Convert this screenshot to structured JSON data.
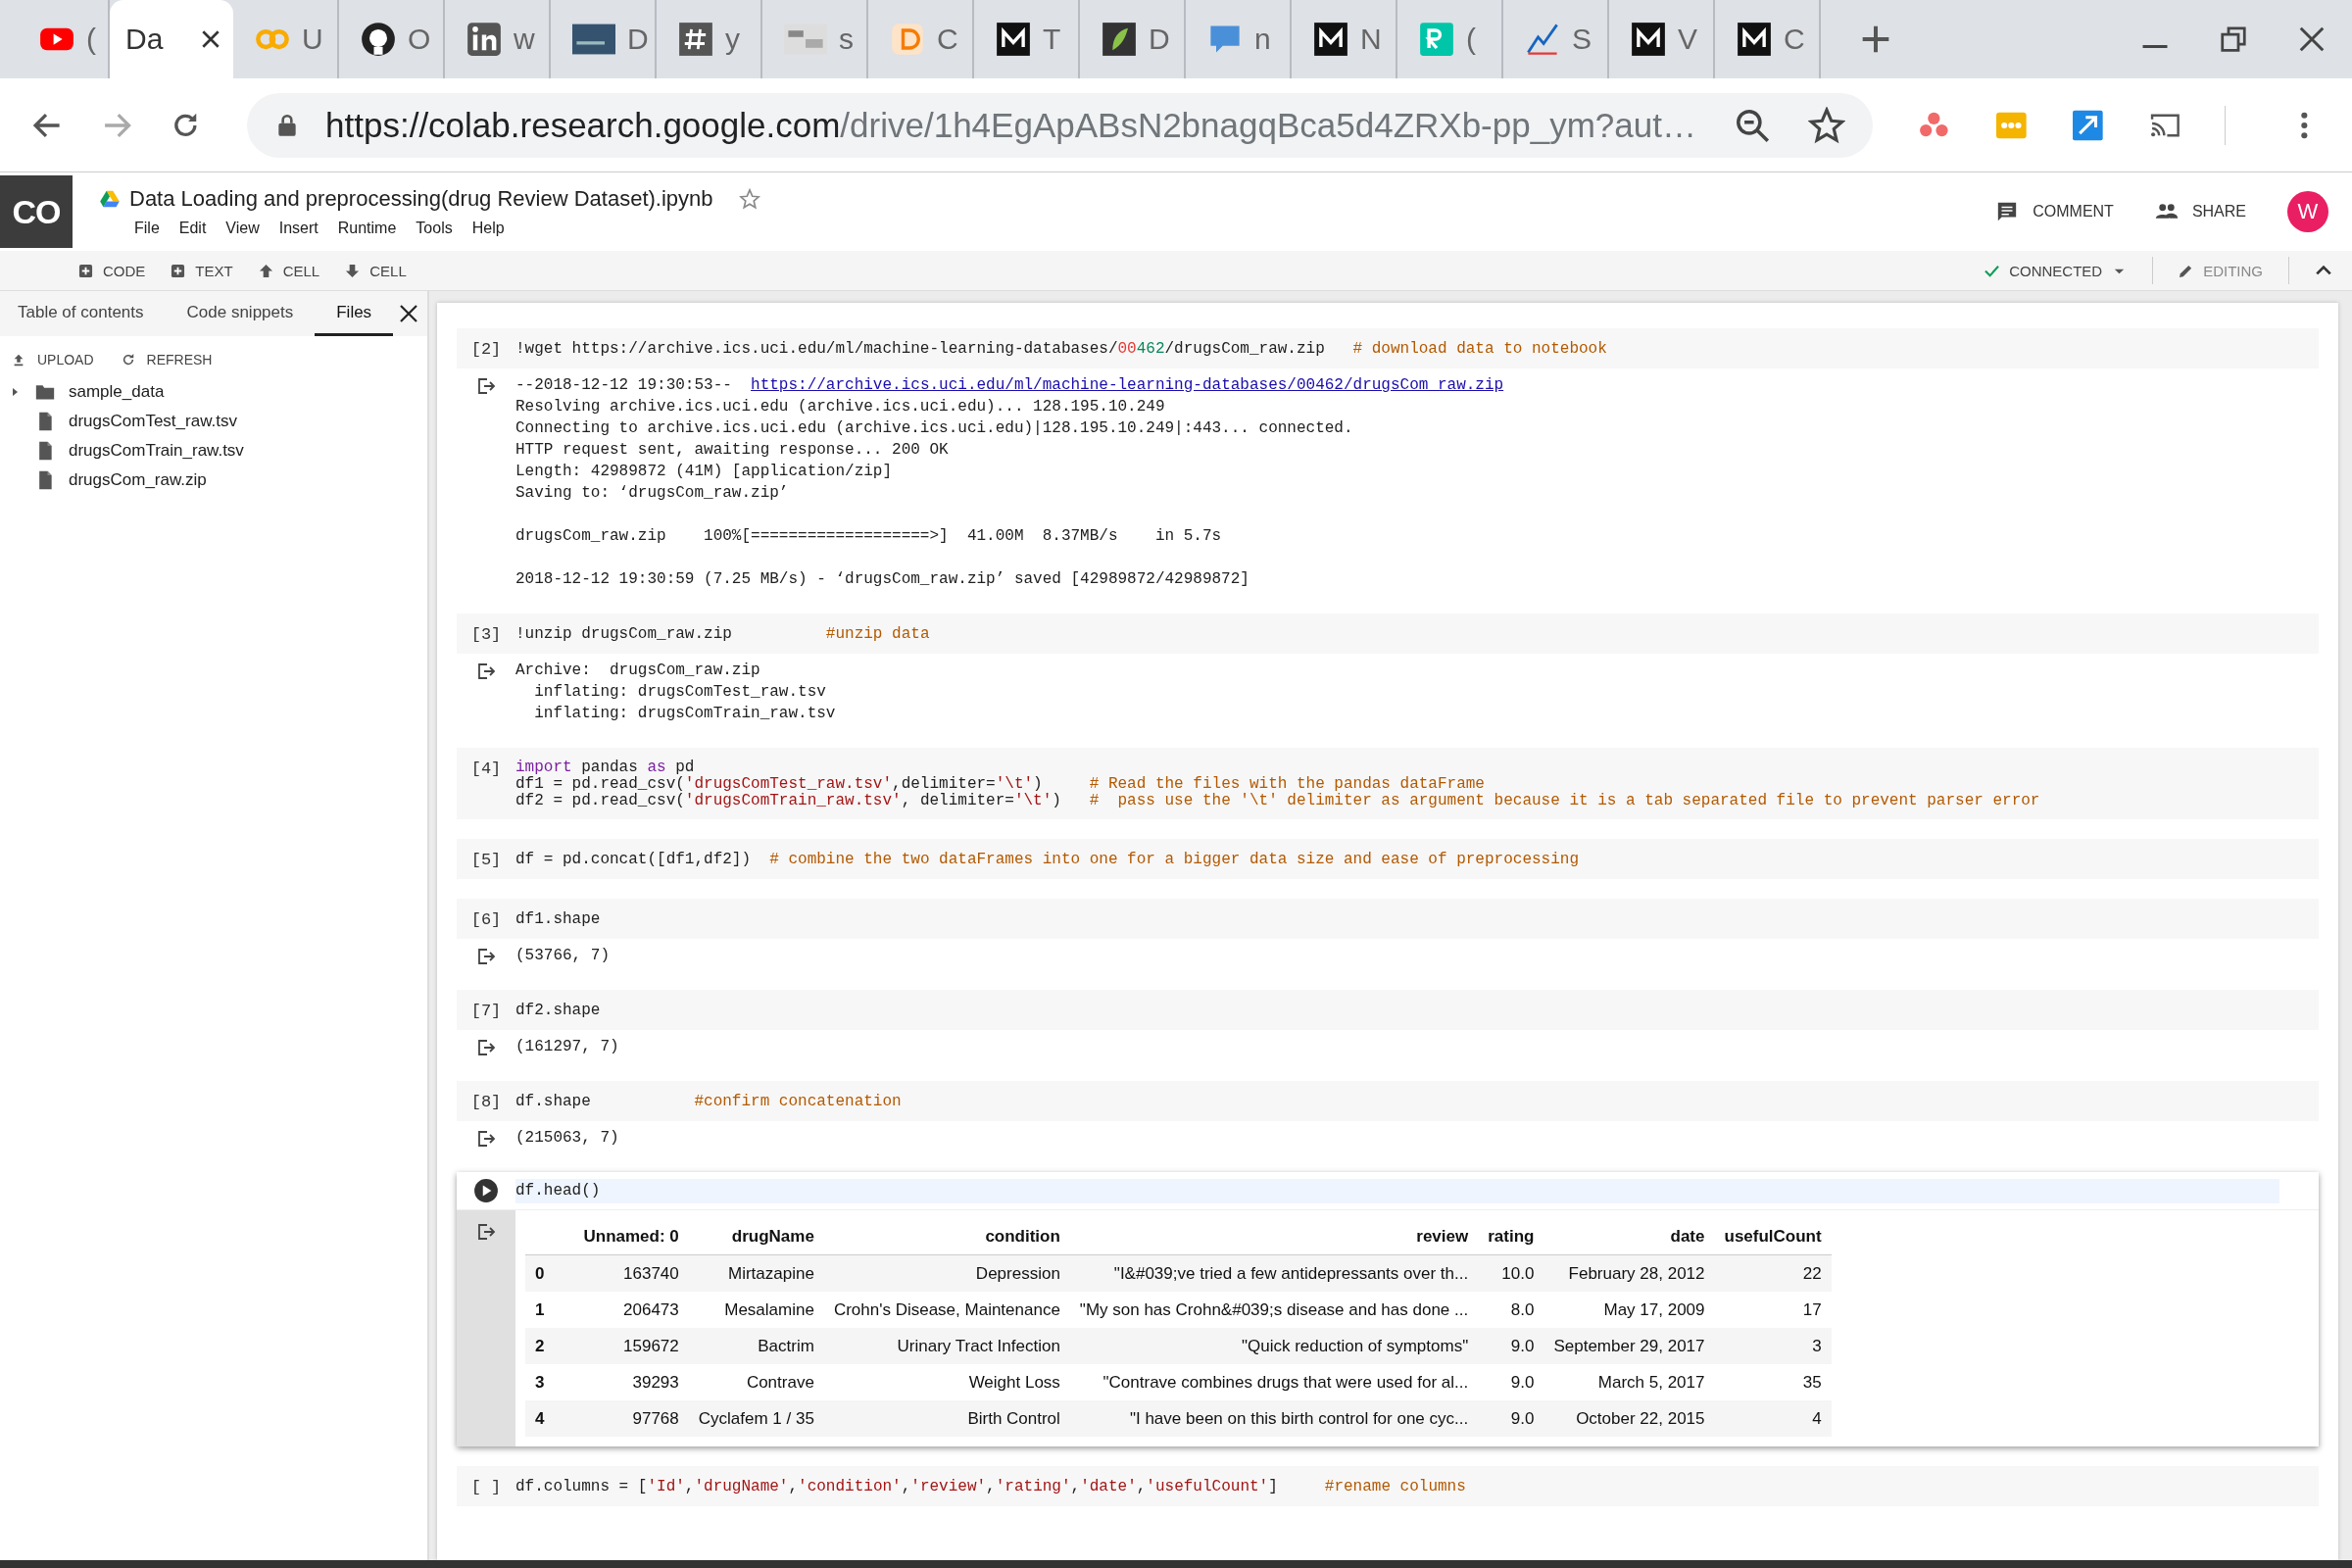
{
  "browser_tabs": [
    {
      "title": "(",
      "selected": false
    },
    {
      "title": "Da",
      "selected": true
    },
    {
      "title": "U",
      "selected": false
    },
    {
      "title": "O",
      "selected": false
    },
    {
      "title": "w",
      "selected": false
    },
    {
      "title": "D",
      "selected": false
    },
    {
      "title": "y",
      "selected": false
    },
    {
      "title": "s",
      "selected": false
    },
    {
      "title": "C",
      "selected": false
    },
    {
      "title": "T",
      "selected": false
    },
    {
      "title": "D",
      "selected": false
    },
    {
      "title": "n",
      "selected": false
    },
    {
      "title": "N",
      "selected": false
    },
    {
      "title": "(",
      "selected": false
    },
    {
      "title": "S",
      "selected": false
    },
    {
      "title": "V",
      "selected": false
    },
    {
      "title": "C",
      "selected": false
    }
  ],
  "address_bar": {
    "host": "https://colab.research.google.com",
    "path": "/drive/1h4EgApABsN2bnagqBca5d4ZRXb-pp_ym?aut…"
  },
  "notebook": {
    "logo": "CO",
    "title": "Data Loading and preprocessing(drug Review Dataset).ipynb",
    "starred": false,
    "menu": [
      "File",
      "Edit",
      "View",
      "Insert",
      "Runtime",
      "Tools",
      "Help"
    ],
    "actions": [
      {
        "kind": "comment",
        "label": "COMMENT"
      },
      {
        "kind": "share",
        "label": "SHARE"
      }
    ],
    "avatar": "W"
  },
  "toolbar": {
    "left": [
      {
        "kind": "add",
        "label": "CODE"
      },
      {
        "kind": "add",
        "label": "TEXT"
      },
      {
        "kind": "up",
        "label": "CELL"
      },
      {
        "kind": "down",
        "label": "CELL"
      }
    ],
    "status": "CONNECTED",
    "mode": "EDITING"
  },
  "sidebar": {
    "tabs": [
      {
        "label": "Table of contents",
        "selected": false
      },
      {
        "label": "Code snippets",
        "selected": false
      },
      {
        "label": "Files",
        "selected": true
      }
    ],
    "actions": [
      {
        "kind": "upload",
        "label": "UPLOAD"
      },
      {
        "kind": "refresh",
        "label": "REFRESH"
      }
    ],
    "files": [
      {
        "name": "sample_data",
        "kind": "folder",
        "expanded": false
      },
      {
        "name": "drugsComTest_raw.tsv",
        "kind": "file"
      },
      {
        "name": "drugsComTrain_raw.tsv",
        "kind": "file"
      },
      {
        "name": "drugsCom_raw.zip",
        "kind": "file"
      }
    ]
  },
  "cells": [
    {
      "prompt": "[2]",
      "selected": false,
      "lines": [
        [
          {
            "text": "!wget https://archive.ics.uci.edu/ml/machine-learning-databases/",
            "kind": "plain"
          },
          {
            "text": "00",
            "kind": "literal"
          },
          {
            "text": "462",
            "kind": "number"
          },
          {
            "text": "/drugsCom_raw.zip   ",
            "kind": "plain"
          },
          {
            "text": "# download data to notebook",
            "kind": "comment"
          }
        ]
      ],
      "output": {
        "paragraphs": [
          [
            [
              {
                "text": "--2018-12-12 19:30:53--  ",
                "kind": "plain"
              },
              {
                "text": "https://archive.ics.uci.edu/ml/machine-learning-databases/00462/drugsCom_raw.zip",
                "kind": "link"
              }
            ],
            [
              {
                "text": "Resolving archive.ics.uci.edu (archive.ics.uci.edu)... 128.195.10.249",
                "kind": "plain"
              }
            ],
            [
              {
                "text": "Connecting to archive.ics.uci.edu (archive.ics.uci.edu)|128.195.10.249|:443... connected.",
                "kind": "plain"
              }
            ],
            [
              {
                "text": "HTTP request sent, awaiting response... 200 OK",
                "kind": "plain"
              }
            ],
            [
              {
                "text": "Length: 42989872 (41M) [application/zip]",
                "kind": "plain"
              }
            ],
            [
              {
                "text": "Saving to: ‘drugsCom_raw.zip’",
                "kind": "plain"
              }
            ]
          ],
          [
            [
              {
                "text": "drugsCom_raw.zip    100%[===================>]  41.00M  8.37MB/s    in 5.7s",
                "kind": "plain"
              }
            ]
          ],
          [
            [
              {
                "text": "2018-12-12 19:30:59 (7.25 MB/s) - ‘drugsCom_raw.zip’ saved [42989872/42989872]",
                "kind": "plain"
              }
            ]
          ]
        ]
      }
    },
    {
      "prompt": "[3]",
      "selected": false,
      "lines": [
        [
          {
            "text": "!unzip drugsCom_raw.zip          ",
            "kind": "plain"
          },
          {
            "text": "#unzip data",
            "kind": "comment"
          }
        ]
      ],
      "output": {
        "paragraphs": [
          [
            [
              {
                "text": "Archive:  drugsCom_raw.zip",
                "kind": "plain"
              }
            ],
            [
              {
                "text": "  inflating: drugsComTest_raw.tsv",
                "kind": "plain"
              }
            ],
            [
              {
                "text": "  inflating: drugsComTrain_raw.tsv",
                "kind": "plain"
              }
            ]
          ]
        ]
      }
    },
    {
      "prompt": "[4]",
      "selected": false,
      "lines": [
        [
          {
            "text": "import",
            "kind": "keyword"
          },
          {
            "text": " pandas ",
            "kind": "plain"
          },
          {
            "text": "as",
            "kind": "keyword"
          },
          {
            "text": " pd",
            "kind": "plain"
          }
        ],
        [
          {
            "text": "df1 = pd.read_csv(",
            "kind": "plain"
          },
          {
            "text": "'drugsComTest_raw.tsv'",
            "kind": "string"
          },
          {
            "text": ",delimiter=",
            "kind": "plain"
          },
          {
            "text": "'\\t'",
            "kind": "string"
          },
          {
            "text": ")     ",
            "kind": "plain"
          },
          {
            "text": "# Read the files with the pandas dataFrame",
            "kind": "comment"
          }
        ],
        [
          {
            "text": "df2 = pd.read_csv(",
            "kind": "plain"
          },
          {
            "text": "'drugsComTrain_raw.tsv'",
            "kind": "string"
          },
          {
            "text": ", delimiter=",
            "kind": "plain"
          },
          {
            "text": "'\\t'",
            "kind": "string"
          },
          {
            "text": ")   ",
            "kind": "plain"
          },
          {
            "text": "#  pass use the '\\t' delimiter as argument because it is a tab separated file to prevent parser error",
            "kind": "comment"
          }
        ]
      ]
    },
    {
      "prompt": "[5]",
      "selected": false,
      "lines": [
        [
          {
            "text": "df = pd.concat([df1,df2])  ",
            "kind": "plain"
          },
          {
            "text": "# combine the two dataFrames into one for a bigger data size and ease of preprocessing",
            "kind": "comment"
          }
        ]
      ]
    },
    {
      "prompt": "[6]",
      "selected": false,
      "lines": [
        [
          {
            "text": "df1.shape",
            "kind": "plain"
          }
        ]
      ],
      "output": {
        "paragraphs": [
          [
            [
              {
                "text": "(53766, 7)",
                "kind": "plain"
              }
            ]
          ]
        ]
      }
    },
    {
      "prompt": "[7]",
      "selected": false,
      "lines": [
        [
          {
            "text": "df2.shape",
            "kind": "plain"
          }
        ]
      ],
      "output": {
        "paragraphs": [
          [
            [
              {
                "text": "(161297, 7)",
                "kind": "plain"
              }
            ]
          ]
        ]
      }
    },
    {
      "prompt": "[8]",
      "selected": false,
      "lines": [
        [
          {
            "text": "df.shape           ",
            "kind": "plain"
          },
          {
            "text": "#confirm concatenation",
            "kind": "comment"
          }
        ]
      ],
      "output": {
        "paragraphs": [
          [
            [
              {
                "text": "(215063, 7)",
                "kind": "plain"
              }
            ]
          ]
        ]
      }
    },
    {
      "selected": true,
      "lines": [
        [
          {
            "text": "df.head()",
            "kind": "plain"
          }
        ]
      ],
      "table": {
        "columns": [
          "Unnamed: 0",
          "drugName",
          "condition",
          "review",
          "rating",
          "date",
          "usefulCount"
        ],
        "rows": [
          {
            "index": "0",
            "cells": [
              "163740",
              "Mirtazapine",
              "Depression",
              "\"I&#039;ve tried a few antidepressants over th...",
              "10.0",
              "February 28, 2012",
              "22"
            ]
          },
          {
            "index": "1",
            "cells": [
              "206473",
              "Mesalamine",
              "Crohn's Disease, Maintenance",
              "\"My son has Crohn&#039;s disease and has done ...",
              "8.0",
              "May 17, 2009",
              "17"
            ]
          },
          {
            "index": "2",
            "cells": [
              "159672",
              "Bactrim",
              "Urinary Tract Infection",
              "\"Quick reduction of symptoms\"",
              "9.0",
              "September 29, 2017",
              "3"
            ]
          },
          {
            "index": "3",
            "cells": [
              "39293",
              "Contrave",
              "Weight Loss",
              "\"Contrave combines drugs that were used for al...",
              "9.0",
              "March 5, 2017",
              "35"
            ]
          },
          {
            "index": "4",
            "cells": [
              "97768",
              "Cyclafem 1 / 35",
              "Birth Control",
              "\"I have been on this birth control for one cyc...",
              "9.0",
              "October 22, 2015",
              "4"
            ]
          }
        ]
      }
    },
    {
      "prompt": "[ ]",
      "selected": false,
      "lines": [
        [
          {
            "text": "df.columns = [",
            "kind": "plain"
          },
          {
            "text": "'Id'",
            "kind": "string"
          },
          {
            "text": ",",
            "kind": "plain"
          },
          {
            "text": "'drugName'",
            "kind": "string"
          },
          {
            "text": ",",
            "kind": "plain"
          },
          {
            "text": "'condition'",
            "kind": "string"
          },
          {
            "text": ",",
            "kind": "plain"
          },
          {
            "text": "'review'",
            "kind": "string"
          },
          {
            "text": ",",
            "kind": "plain"
          },
          {
            "text": "'rating'",
            "kind": "string"
          },
          {
            "text": ",",
            "kind": "plain"
          },
          {
            "text": "'date'",
            "kind": "string"
          },
          {
            "text": ",",
            "kind": "plain"
          },
          {
            "text": "'usefulCount'",
            "kind": "string"
          },
          {
            "text": "]     ",
            "kind": "plain"
          },
          {
            "text": "#rename columns",
            "kind": "comment"
          }
        ]
      ]
    }
  ]
}
